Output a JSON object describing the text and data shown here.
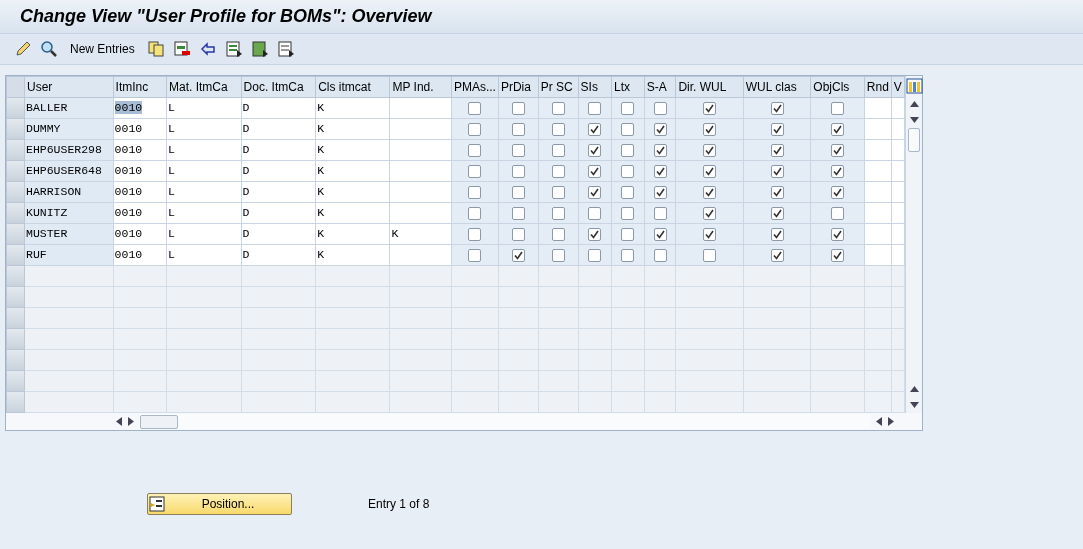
{
  "title": "Change View \"User Profile for BOMs\": Overview",
  "toolbar": {
    "new_entries": "New Entries"
  },
  "table": {
    "columns": [
      {
        "label": "User",
        "kind": "text"
      },
      {
        "label": "ItmInc",
        "kind": "text"
      },
      {
        "label": "Mat. ItmCa",
        "kind": "text"
      },
      {
        "label": "Doc. ItmCa",
        "kind": "text"
      },
      {
        "label": "Cls itmcat",
        "kind": "text"
      },
      {
        "label": "MP Ind.",
        "kind": "text"
      },
      {
        "label": "PMAs...",
        "kind": "check"
      },
      {
        "label": "PrDia",
        "kind": "check"
      },
      {
        "label": "Pr SC",
        "kind": "check"
      },
      {
        "label": "SIs",
        "kind": "check"
      },
      {
        "label": "Ltx",
        "kind": "check"
      },
      {
        "label": "S-A",
        "kind": "check"
      },
      {
        "label": "Dir. WUL",
        "kind": "check"
      },
      {
        "label": "WUL clas",
        "kind": "check"
      },
      {
        "label": "ObjCls",
        "kind": "check"
      },
      {
        "label": "Rnd",
        "kind": "text"
      },
      {
        "label": "V",
        "kind": "text"
      }
    ],
    "rows": [
      {
        "cells": [
          "BALLER",
          "0010",
          "L",
          "D",
          "K",
          "",
          false,
          false,
          false,
          false,
          false,
          false,
          true,
          true,
          false,
          "",
          ""
        ],
        "itminc_selected": true
      },
      {
        "cells": [
          "DUMMY",
          "0010",
          "L",
          "D",
          "K",
          "",
          false,
          false,
          false,
          true,
          false,
          true,
          true,
          true,
          true,
          "",
          ""
        ],
        "itminc_selected": false
      },
      {
        "cells": [
          "EHP6USER298",
          "0010",
          "L",
          "D",
          "K",
          "",
          false,
          false,
          false,
          true,
          false,
          true,
          true,
          true,
          true,
          "",
          ""
        ],
        "itminc_selected": false
      },
      {
        "cells": [
          "EHP6USER648",
          "0010",
          "L",
          "D",
          "K",
          "",
          false,
          false,
          false,
          true,
          false,
          true,
          true,
          true,
          true,
          "",
          ""
        ],
        "itminc_selected": false
      },
      {
        "cells": [
          "HARRISON",
          "0010",
          "L",
          "D",
          "K",
          "",
          false,
          false,
          false,
          true,
          false,
          true,
          true,
          true,
          true,
          "",
          ""
        ],
        "itminc_selected": false
      },
      {
        "cells": [
          "KUNITZ",
          "0010",
          "L",
          "D",
          "K",
          "",
          false,
          false,
          false,
          false,
          false,
          false,
          true,
          true,
          false,
          "",
          ""
        ],
        "itminc_selected": false
      },
      {
        "cells": [
          "MUSTER",
          "0010",
          "L",
          "D",
          "K",
          "K",
          false,
          false,
          false,
          true,
          false,
          true,
          true,
          true,
          true,
          "",
          ""
        ],
        "itminc_selected": false
      },
      {
        "cells": [
          "RUF",
          "0010",
          "L",
          "D",
          "K",
          "",
          false,
          true,
          false,
          false,
          false,
          false,
          false,
          true,
          true,
          "",
          ""
        ],
        "itminc_selected": false
      }
    ]
  },
  "position_button": "Position...",
  "entry_info": "Entry 1 of 8"
}
